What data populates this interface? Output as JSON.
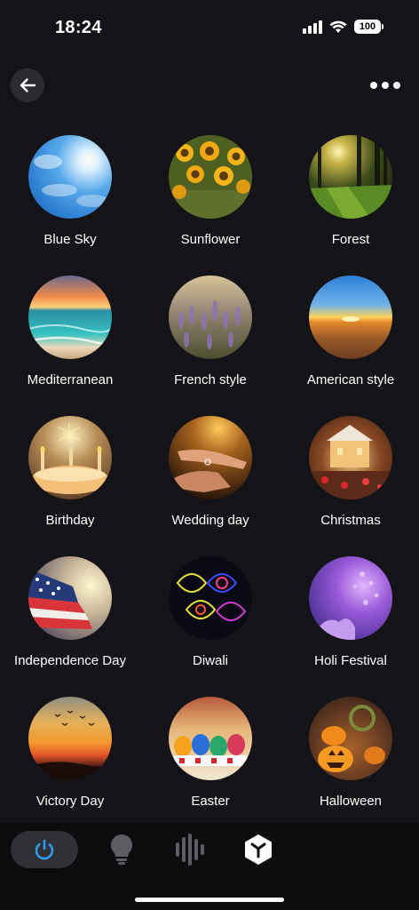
{
  "status": {
    "time": "18:24",
    "battery": "100"
  },
  "scenes": [
    {
      "label": "Blue Sky"
    },
    {
      "label": "Sunflower"
    },
    {
      "label": "Forest"
    },
    {
      "label": "Mediterranean"
    },
    {
      "label": "French style"
    },
    {
      "label": "American style"
    },
    {
      "label": "Birthday"
    },
    {
      "label": "Wedding day"
    },
    {
      "label": "Christmas"
    },
    {
      "label": "Independence Day"
    },
    {
      "label": "Diwali"
    },
    {
      "label": "Holi Festival"
    },
    {
      "label": "Victory Day"
    },
    {
      "label": "Easter"
    },
    {
      "label": "Halloween"
    }
  ],
  "colors": {
    "background": "#141418",
    "accent": "#2e9bf0",
    "tabbar": "#0c0c0e"
  },
  "tabbar": {
    "active": "power",
    "tabs": [
      "power-icon",
      "bulb-icon",
      "sound-icon",
      "scene-icon"
    ]
  }
}
